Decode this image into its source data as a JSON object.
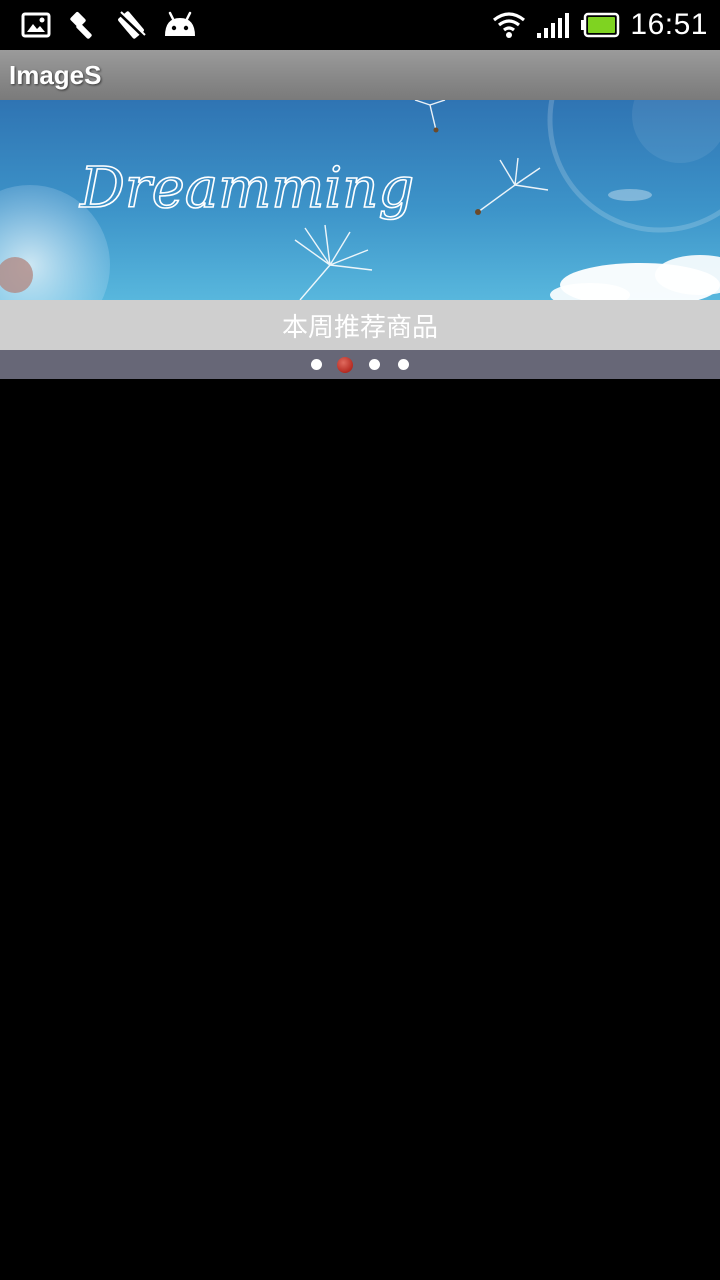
{
  "status_bar": {
    "icons_left": [
      "gallery-icon",
      "tool-icon",
      "no-signal-icon",
      "android-icon"
    ],
    "icons_right": [
      "wifi-icon",
      "signal-icon",
      "battery-icon"
    ],
    "battery_level": 1.0,
    "battery_color": "#7fd321",
    "time": "16:51"
  },
  "title_bar": {
    "title": "ImageS"
  },
  "banner": {
    "image_text": "Dreamming",
    "caption": "本周推荐商品"
  },
  "pager": {
    "page_count": 4,
    "active_index": 1,
    "active_color": "#c0392b"
  }
}
